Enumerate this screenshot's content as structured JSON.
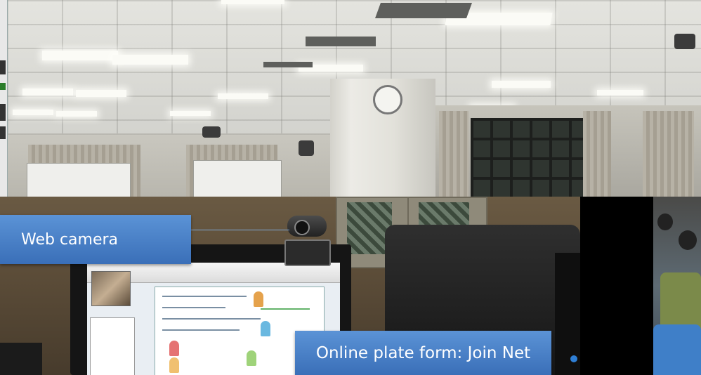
{
  "callouts": {
    "webcam_label": "Web camera",
    "platform_label": "Online plate form: Join Net"
  },
  "colors": {
    "callout_fill": "#4a82c8",
    "callout_text": "#ffffff"
  }
}
